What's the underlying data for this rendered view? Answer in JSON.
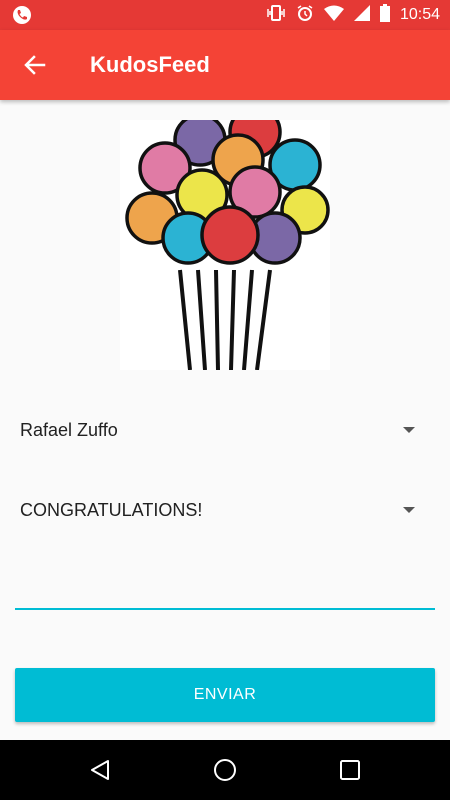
{
  "status_bar": {
    "time": "10:54",
    "icons": [
      "phone-call-icon",
      "vibrate-icon",
      "alarm-icon",
      "wifi-icon",
      "signal-icon",
      "battery-icon"
    ]
  },
  "app_bar": {
    "title": "KudosFeed",
    "back_icon": "back-arrow-icon",
    "color": "#f44336"
  },
  "image": {
    "icon": "balloons-image"
  },
  "form": {
    "recipient_value": "Rafael Zuffo",
    "type_value": "CONGRATULATIONS!",
    "message_value": "",
    "message_accent": "#00bcd4"
  },
  "send_button": {
    "label": "ENVIAR",
    "color": "#00bcd4"
  },
  "nav_bar": {
    "icons": [
      "back-triangle-icon",
      "home-circle-icon",
      "recents-square-icon"
    ]
  }
}
